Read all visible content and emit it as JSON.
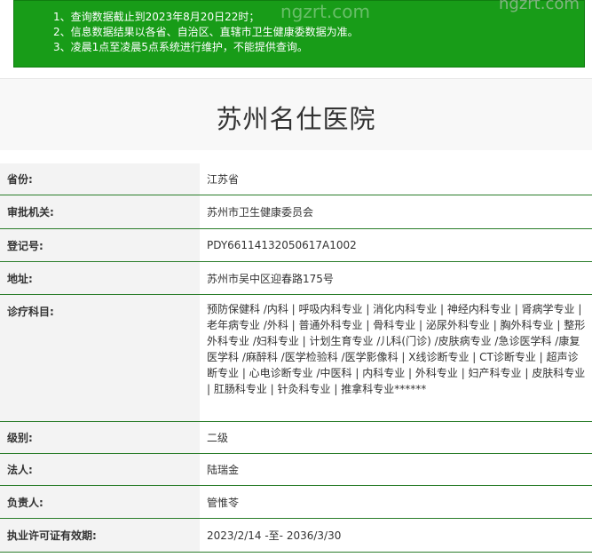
{
  "notice": {
    "lines": [
      "1、查询数据截止到2023年8月20日22时；",
      "2、信息数据结果以各省、自治区、直辖市卫生健康委数据为准。",
      "3、凌晨1点至凌晨5点系统进行维护，不能提供查询。"
    ],
    "background_color": "#189c18"
  },
  "watermark": {
    "text1": "ngzrt.com",
    "text2": "ngzrt.com"
  },
  "title": "苏州名仕医院",
  "fields": {
    "province": {
      "label": "省份:",
      "value": "江苏省"
    },
    "approval": {
      "label": "审批机关:",
      "value": "苏州市卫生健康委员会"
    },
    "register": {
      "label": "登记号:",
      "value": "PDY66114132050617A1002"
    },
    "address": {
      "label": "地址:",
      "value": "苏州市吴中区迎春路175号"
    },
    "subjects": {
      "label": "诊疗科目:",
      "value": "预防保健科 /内科 | 呼吸内科专业 | 消化内科专业 | 神经内科专业 | 肾病学专业 | 老年病专业 /外科 | 普通外科专业 | 骨科专业 | 泌尿外科专业 | 胸外科专业 | 整形外科专业 /妇科专业 | 计划生育专业 /儿科(门诊) /皮肤病专业 /急诊医学科 /康复医学科 /麻醉科 /医学检验科 /医学影像科 | X线诊断专业 | CT诊断专业 | 超声诊断专业 | 心电诊断专业 /中医科 | 内科专业 | 外科专业 | 妇产科专业 | 皮肤科专业 | 肛肠科专业 | 针灸科专业 | 推拿科专业******"
    },
    "level": {
      "label": "级别:",
      "value": "二级"
    },
    "legal": {
      "label": "法人:",
      "value": "陆瑞金"
    },
    "director": {
      "label": "负责人:",
      "value": "管惟苓"
    },
    "validity": {
      "label": "执业许可证有效期:",
      "value": "2023/2/14 -至- 2036/3/30"
    }
  },
  "colors": {
    "row_divider": "#2a7d2a",
    "label_bg": "#f3f3f3"
  }
}
